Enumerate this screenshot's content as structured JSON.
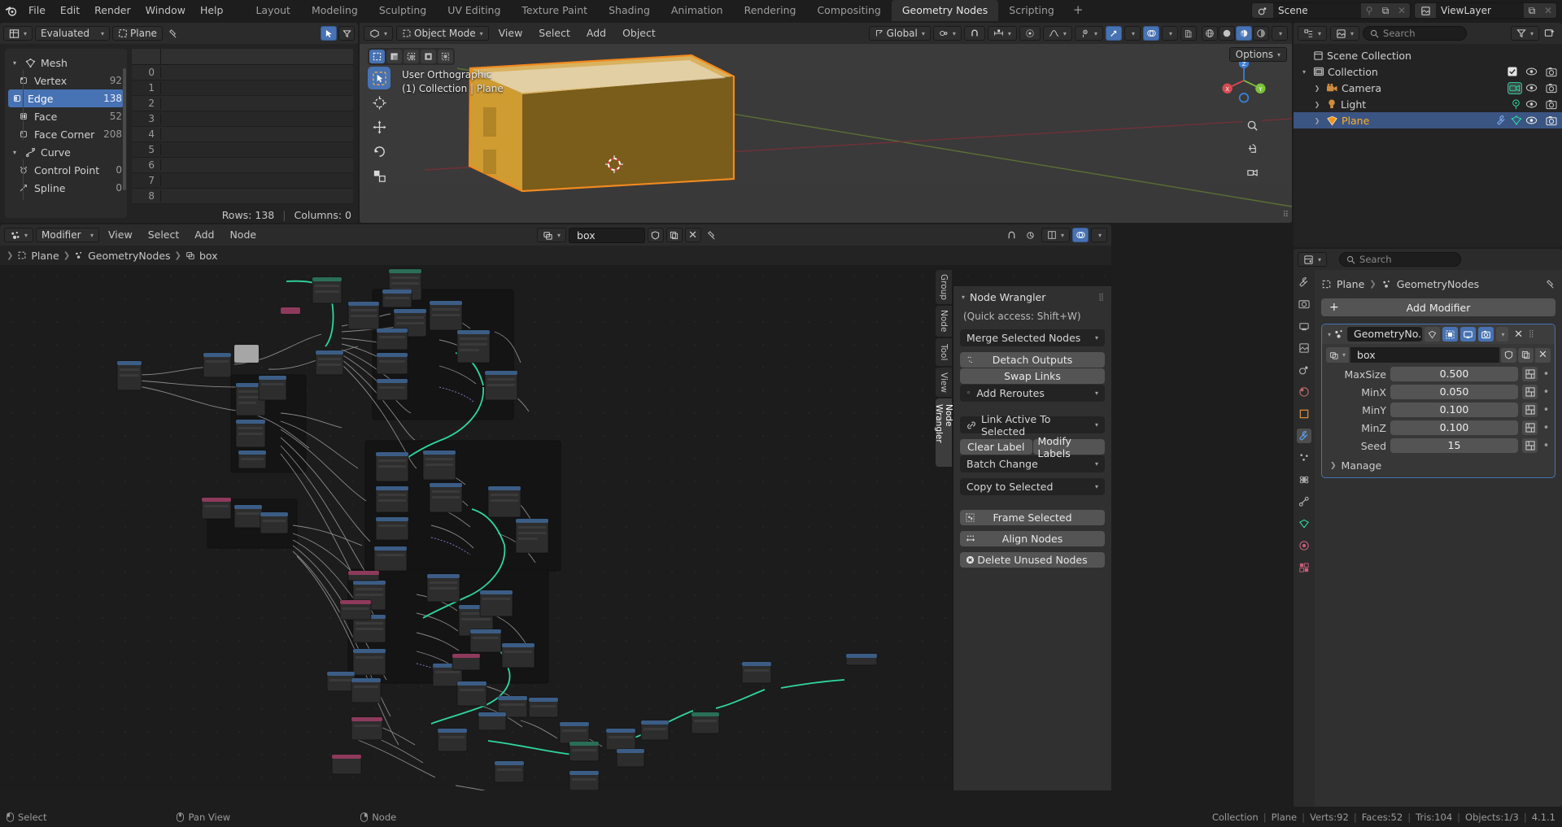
{
  "topbar": {
    "logo_icon": "blender-logo-icon",
    "menus": [
      "File",
      "Edit",
      "Render",
      "Window",
      "Help"
    ],
    "workspaces": [
      "Layout",
      "Modeling",
      "Sculpting",
      "UV Editing",
      "Texture Paint",
      "Shading",
      "Animation",
      "Rendering",
      "Compositing",
      "Geometry Nodes",
      "Scripting"
    ],
    "active_workspace": "Geometry Nodes",
    "add_workspace_label": "+",
    "scene_name": "Scene",
    "viewlayer_name": "ViewLayer"
  },
  "spreadsheet": {
    "editor_icon": "spreadsheet-editor-icon",
    "dataset_mode": "Evaluated",
    "object_name": "Plane",
    "pin_icon": "pin-icon",
    "filter_icon": "filter-icon",
    "cursor_icon": "cursor-select-icon",
    "tree": [
      {
        "label": "Mesh",
        "count": "",
        "icon": "mesh-data-icon",
        "level": 0,
        "expanded": true,
        "selected": false
      },
      {
        "label": "Vertex",
        "count": "92",
        "icon": "vertex-icon",
        "level": 1,
        "expanded": false,
        "selected": false
      },
      {
        "label": "Edge",
        "count": "138",
        "icon": "edge-icon",
        "level": 1,
        "expanded": false,
        "selected": true
      },
      {
        "label": "Face",
        "count": "52",
        "icon": "face-icon",
        "level": 1,
        "expanded": false,
        "selected": false
      },
      {
        "label": "Face Corner",
        "count": "208",
        "icon": "face-corner-icon",
        "level": 1,
        "expanded": false,
        "selected": false
      },
      {
        "label": "Curve",
        "count": "",
        "icon": "curve-data-icon",
        "level": 0,
        "expanded": true,
        "selected": false
      },
      {
        "label": "Control Point",
        "count": "0",
        "icon": "control-point-icon",
        "level": 1,
        "expanded": false,
        "selected": false
      },
      {
        "label": "Spline",
        "count": "0",
        "icon": "spline-icon",
        "level": 1,
        "expanded": false,
        "selected": false
      }
    ],
    "row_indices": [
      "0",
      "1",
      "2",
      "3",
      "4",
      "5",
      "6",
      "7",
      "8"
    ],
    "footer_rows": "Rows: 138",
    "footer_columns": "Columns: 0"
  },
  "viewport": {
    "editor_icon": "3d-viewport-icon",
    "mode": "Object Mode",
    "menus": [
      "View",
      "Select",
      "Add",
      "Object"
    ],
    "transform_orientation": "Global",
    "snap_icon": "magnet-icon",
    "proportional_icon": "proportional-edit-icon",
    "overlay_text_line1": "User Orthographic",
    "overlay_text_line2": "(1) Collection | Plane",
    "options_label": "Options",
    "gizmo_axes": [
      "X",
      "Y",
      "Z"
    ],
    "shading_modes": [
      "wireframe",
      "solid",
      "material-preview",
      "rendered"
    ],
    "active_shading": "material-preview",
    "tools": [
      "tweak-select-tool",
      "cursor-tool",
      "move-tool",
      "rotate-tool",
      "scale-tool"
    ],
    "active_tool": "tweak-select-tool",
    "select_modes": [
      "set-new",
      "extend",
      "subtract",
      "invert",
      "intersect"
    ]
  },
  "node_editor": {
    "editor_icon": "geometry-nodes-editor-icon",
    "type_label": "Modifier",
    "menus": [
      "View",
      "Select",
      "Add",
      "Node"
    ],
    "tree_name": "box",
    "shield_icon": "fake-user-icon",
    "copy_icon": "duplicate-icon",
    "close_icon": "unlink-icon",
    "pin_icon": "pin-icon",
    "snap_icon": "snap-icon",
    "overlay_icon": "overlays-icon",
    "breadcrumb": [
      "Plane",
      "GeometryNodes",
      "box"
    ],
    "side_tabs": [
      "Group",
      "Node",
      "Tool",
      "View",
      "Node Wrangler"
    ],
    "active_side_tab": "Node Wrangler",
    "node_wrangler": {
      "panel_title": "Node Wrangler",
      "quick_access": "(Quick access: Shift+W)",
      "merge_label": "Merge Selected Nodes",
      "detach_outputs": "Detach Outputs",
      "swap_links": "Swap Links",
      "add_reroutes": "Add Reroutes",
      "link_active": "Link Active To Selected",
      "clear_label": "Clear Label",
      "modify_labels": "Modify Labels",
      "batch_change": "Batch Change",
      "copy_to_selected": "Copy to Selected",
      "frame_selected": "Frame Selected",
      "align_nodes": "Align Nodes",
      "delete_unused": "Delete Unused Nodes"
    }
  },
  "outliner": {
    "display_mode_icon": "outliner-display-mode-icon",
    "filter_id_icon": "viewlayer-icon",
    "search_placeholder": "Search",
    "filter_icon": "filter-icon",
    "new_collection_icon": "new-collection-icon",
    "rows": [
      {
        "name": "Scene Collection",
        "icon": "scene-collection-icon",
        "level": 0,
        "selected": false,
        "has_tri": false,
        "checkbox": false,
        "eye": false,
        "camera": false
      },
      {
        "name": "Collection",
        "icon": "collection-icon",
        "level": 0,
        "selected": false,
        "has_tri": true,
        "checkbox": true,
        "eye": true,
        "camera": true
      },
      {
        "name": "Camera",
        "icon": "camera-object-icon",
        "level": 1,
        "selected": false,
        "has_tri": true,
        "checkbox": false,
        "eye": true,
        "camera": true,
        "data_icon": "camera-data-icon"
      },
      {
        "name": "Light",
        "icon": "light-object-icon",
        "level": 1,
        "selected": false,
        "has_tri": true,
        "checkbox": false,
        "eye": true,
        "camera": true,
        "data_icon": "light-data-icon"
      },
      {
        "name": "Plane",
        "icon": "mesh-object-icon",
        "level": 1,
        "selected": true,
        "has_tri": true,
        "checkbox": false,
        "eye": true,
        "camera": true,
        "data_icon": "modifier-icon"
      }
    ]
  },
  "properties": {
    "editor_icon": "properties-editor-icon",
    "search_placeholder": "Search",
    "breadcrumb": [
      "Plane",
      "GeometryNodes"
    ],
    "pin_icon": "pin-icon",
    "add_modifier_label": "Add Modifier",
    "add_modifier_icon": "plus-icon",
    "modifier": {
      "name": "GeometryNo...",
      "icon": "geometry-nodes-icon",
      "toggles": [
        "edit-mode-display",
        "realtime-display",
        "viewport-display",
        "render-display"
      ],
      "toggles_on": [
        false,
        true,
        true,
        true
      ],
      "dropdown_icon": "chevron-down-icon",
      "close_icon": "x-icon",
      "grip_icon": "grip-icon",
      "node_group": "box",
      "shield_icon": "fake-user-icon",
      "copy_icon": "duplicate-icon",
      "unlink_icon": "x-icon",
      "inputs": [
        {
          "label": "MaxSize",
          "value": "0.500"
        },
        {
          "label": "MinX",
          "value": "0.050"
        },
        {
          "label": "MinY",
          "value": "0.100"
        },
        {
          "label": "MinZ",
          "value": "0.100"
        },
        {
          "label": "Seed",
          "value": "15"
        }
      ],
      "manage_label": "Manage"
    },
    "tabs": [
      "tool-tab",
      "render-tab",
      "output-tab",
      "viewlayer-tab",
      "scene-tab",
      "world-tab",
      "object-tab",
      "modifier-tab",
      "particles-tab",
      "physics-tab",
      "constraints-tab",
      "data-tab",
      "material-tab",
      "texture-tab"
    ],
    "active_tab": "modifier-tab"
  },
  "statusbar": {
    "hints": [
      {
        "icon": "mouse-left-icon",
        "label": "Select"
      },
      {
        "icon": "mouse-middle-icon",
        "label": "Pan View"
      },
      {
        "icon": "mouse-right-icon",
        "label": "Node"
      }
    ],
    "scene_stats": [
      "Collection",
      "Plane",
      "Verts:92",
      "Faces:52",
      "Tris:104",
      "Objects:1/3",
      "4.1.1"
    ]
  },
  "colors": {
    "accent_blue": "#4772b3",
    "selected_orange": "#ffaf29",
    "node_green": "#2fd6a0",
    "panel_bg": "#303030",
    "editor_bg": "#1d1d1d"
  }
}
